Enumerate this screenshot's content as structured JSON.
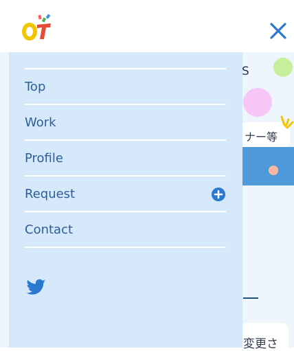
{
  "header": {
    "logo_text": "OT"
  },
  "menu": {
    "items": [
      {
        "label": "Top"
      },
      {
        "label": "Work"
      },
      {
        "label": "Profile"
      },
      {
        "label": "Request",
        "has_plus": true
      },
      {
        "label": "Contact"
      }
    ]
  },
  "background": {
    "fragment_s": "S",
    "fragment_button": "ナー等",
    "fragment_text": "変更さ"
  },
  "colors": {
    "drawer_bg": "#d6e9fb",
    "menu_text": "#2c5d9a",
    "accent": "#2b78d0",
    "twitter": "#2b78d0"
  },
  "icons": {
    "close": "close-icon",
    "plus": "plus-circle-icon",
    "social": "twitter-icon"
  }
}
